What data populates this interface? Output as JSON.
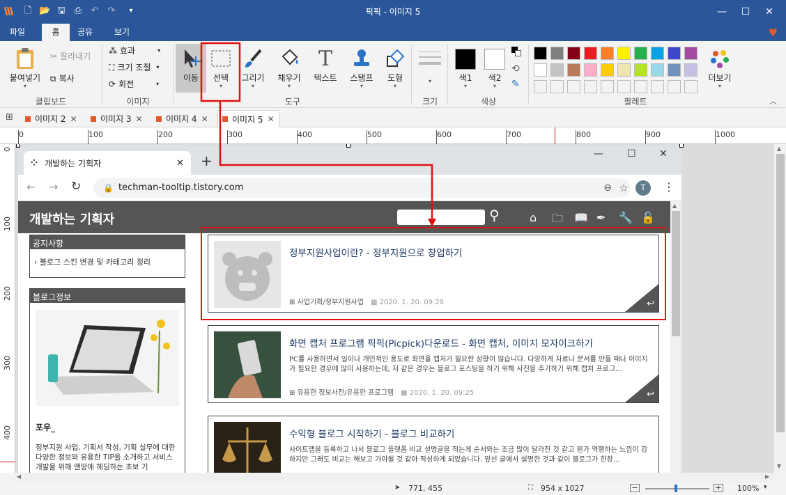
{
  "window": {
    "title": "픽픽 - 이미지 5"
  },
  "menu": {
    "items": [
      "파일",
      "홈",
      "공유",
      "보기"
    ]
  },
  "ribbon": {
    "clipboard": {
      "paste": "붙여넣기",
      "cut": "잘라내기",
      "copy": "복사",
      "group": "클립보드"
    },
    "image": {
      "effect": "효과",
      "resize": "크기 조절",
      "rotate": "회전",
      "group": "이미지"
    },
    "tools": {
      "move": "이동",
      "select": "선택",
      "draw": "그리기",
      "fill": "채우기",
      "text": "텍스트",
      "stamp": "스탬프",
      "shape": "도형",
      "group": "도구"
    },
    "size": {
      "group": "크기"
    },
    "color": {
      "color1": "색1",
      "color2": "색2",
      "group": "색상"
    },
    "palette": {
      "group": "팔레트",
      "more": "더보기",
      "row1": [
        "#000000",
        "#7f7f7f",
        "#880015",
        "#ed1c24",
        "#ff7f27",
        "#fff200",
        "#22b14c",
        "#00a2e8",
        "#3f48cc",
        "#a349a4"
      ],
      "row2": [
        "#ffffff",
        "#c3c3c3",
        "#b97a57",
        "#ffaec9",
        "#ffc90e",
        "#efe4b0",
        "#b5e61d",
        "#99d9ea",
        "#7092be",
        "#c8bfe7"
      ]
    }
  },
  "tabs": [
    {
      "label": "이미지 2"
    },
    {
      "label": "이미지 3"
    },
    {
      "label": "이미지 4"
    },
    {
      "label": "이미지 5"
    }
  ],
  "ruler": {
    "top": [
      "0",
      "100",
      "200",
      "300",
      "400",
      "500",
      "600",
      "700",
      "800",
      "900",
      "1000"
    ],
    "left": [
      "0",
      "100",
      "200",
      "300",
      "400"
    ]
  },
  "browser": {
    "tab_title": "개발하는 기획자",
    "url": "techman-tooltip.tistory.com",
    "avatar": "T"
  },
  "blog": {
    "title": "개발하는 기획자",
    "notice": {
      "header": "공지사항",
      "item": "› 블로그 스킨 변경 및 카테고리 정리"
    },
    "info": {
      "header": "블로그정보",
      "name": "포우_",
      "desc": "정부지원 사업, 기획서 작성, 기획 실무에 대한 다양한 정보와 유용한 TIP을 소개하고 서비스 개발을 위해 맨땅에 헤딩하는 초보 기"
    },
    "posts": [
      {
        "title": "정부지원사업이란? - 정부지원으로 창업하기",
        "excerpt": "",
        "category": "사업기획/정부지원사업",
        "date": "2020. 1. 20. 09:28"
      },
      {
        "title": "화면 캡처 프로그램 픽픽(Picpick)다운로드 - 화면 캡처, 이미지 모자이크하기",
        "excerpt": "PC를 사용하면서 일이나 개인적인 용도로 화면을 캡처가 필요한 상황이 많습니다. 다양하게 자료나 문서를 만들 때나 이미지가 필요한 경우에 많이 사용하는데, 저 같은 경우는 블로그 포스팅을 하기 위해 사진을 추가하기 위해 캡처 프로그...",
        "category": "유용한 정보사전/유용한 프로그램",
        "date": "2020. 1. 20. 09:25"
      },
      {
        "title": "수익형 블로그 시작하기 - 블로그 비교하기",
        "excerpt": "사이트맵을 등록하고 나서 블로그 플랫폼 비교 설명글을 적는게 순서와는 조금 많이 달라진 것 같고 뭔가 역행하는 느낌이 강하지만 그래도 비교는 해보고 가야될 것 같아 작성하게 되었습니다. 앞선 글에서 설명한 것과 같이 블로그가 한창...",
        "category": "",
        "date": ""
      }
    ]
  },
  "status": {
    "cursor": "771, 455",
    "size": "954 x 1027",
    "zoom": "100%"
  }
}
